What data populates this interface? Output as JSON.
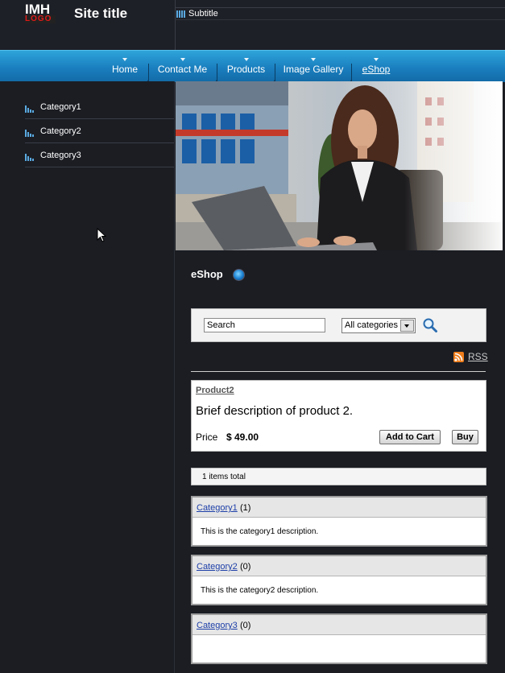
{
  "header": {
    "logo_top": "IMH",
    "logo_bottom": "LOGO",
    "site_title": "Site title",
    "subtitle": "Subtitle"
  },
  "nav": {
    "items": [
      {
        "label": "Home"
      },
      {
        "label": "Contact Me"
      },
      {
        "label": "Products"
      },
      {
        "label": "Image Gallery"
      },
      {
        "label": "eShop",
        "active": true
      }
    ]
  },
  "sidebar": {
    "items": [
      {
        "label": "Category1"
      },
      {
        "label": "Category2"
      },
      {
        "label": "Category3"
      }
    ]
  },
  "main": {
    "heading": "eShop",
    "search": {
      "value": "Search",
      "category_selected": "All categories"
    },
    "rss_label": "RSS",
    "product": {
      "name": "Product2",
      "description": "Brief description of product 2.",
      "price_label": "Price",
      "price": "$ 49.00",
      "add_to_cart_label": "Add to Cart",
      "buy_label": "Buy"
    },
    "total_text": "1 items total",
    "categories": [
      {
        "name": "Category1",
        "count": "(1)",
        "description": "This is the category1 description."
      },
      {
        "name": "Category2",
        "count": "(0)",
        "description": "This is the category2 description."
      },
      {
        "name": "Category3",
        "count": "(0)",
        "description": ""
      }
    ]
  },
  "colors": {
    "background": "#1b1d23",
    "nav_accent": "#1a7fbf",
    "bar_icon": "#5aa9e0",
    "logo_red": "#e01919",
    "link_blue": "#1d3fa8"
  },
  "icons": [
    "bars-icon",
    "search-icon",
    "rss-icon",
    "globe-dot-icon",
    "cursor-icon",
    "dropdown-arrow-icon"
  ]
}
